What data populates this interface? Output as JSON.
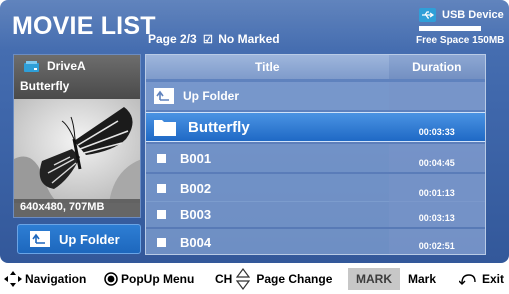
{
  "header": {
    "title": "MOVIE LIST",
    "page_info": "Page 2/3",
    "marked_checkbox": "☑",
    "marked_text": "No Marked"
  },
  "usb": {
    "label": "USB Device",
    "free_space": "Free Space 150MB",
    "free_fraction": 0.45,
    "icon": "usb-icon"
  },
  "preview": {
    "drive": "DriveA",
    "file_name": "Butterfly",
    "info": "640x480, 707MB",
    "icons": [
      "drive-icon",
      "butterfly-thumbnail"
    ]
  },
  "up_button": {
    "label": "Up Folder",
    "icon": "up-folder-icon"
  },
  "list": {
    "columns": {
      "title": "Title",
      "duration": "Duration"
    },
    "up_row": {
      "label": "Up Folder"
    },
    "items": [
      {
        "name": "Butterfly",
        "duration": "00:03:33",
        "type": "folder"
      },
      {
        "name": "B001",
        "duration": "00:04:45",
        "type": "file"
      },
      {
        "name": "B002",
        "duration": "00:01:13",
        "type": "file"
      },
      {
        "name": "B003",
        "duration": "00:03:13",
        "type": "file"
      },
      {
        "name": "B004",
        "duration": "00:02:51",
        "type": "file"
      }
    ]
  },
  "footer": {
    "navigation": "Navigation",
    "popup_menu": "PopUp Menu",
    "ch": "CH",
    "page_change": "Page Change",
    "mark_key": "MARK",
    "mark": "Mark",
    "exit": "Exit"
  },
  "colors": {
    "panel_bg": "#3f67ab",
    "selected_row": "#2d7ad6",
    "text": "#ffffff"
  }
}
